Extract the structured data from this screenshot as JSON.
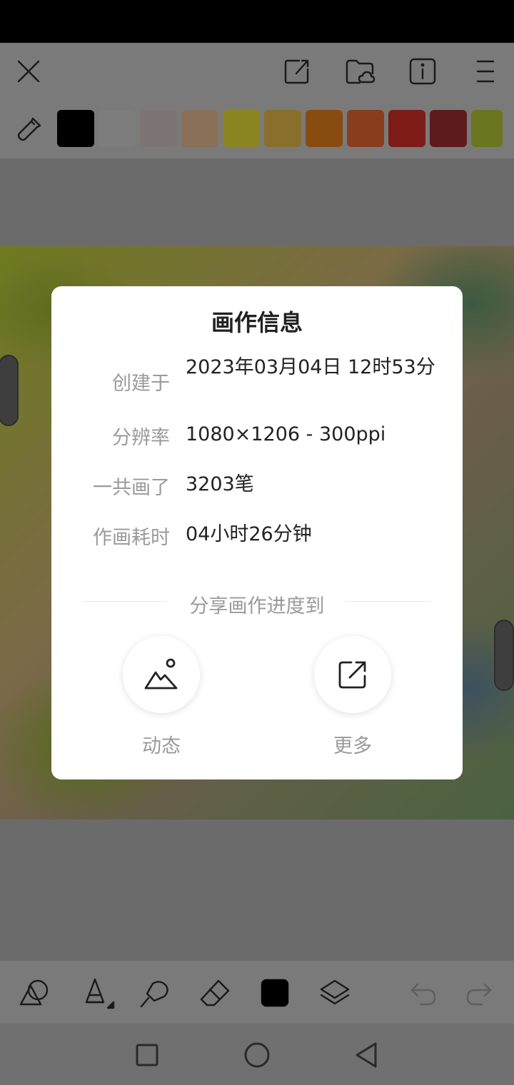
{
  "top_bar": {
    "icons": [
      "close-icon",
      "export-icon",
      "cloud-folder-icon",
      "info-icon",
      "menu-icon"
    ]
  },
  "palette": {
    "colors": [
      "#000000",
      "#7d7d7d",
      "#7c7573",
      "#8b7058",
      "#8a8521",
      "#8a6f2b",
      "#894c10",
      "#8a3d1c",
      "#7d1b17",
      "#5e1b1e",
      "#6a761d"
    ]
  },
  "dialog": {
    "title": "画作信息",
    "rows": [
      {
        "label": "创建于",
        "value": "2023年03月04日 12时53分"
      },
      {
        "label": "分辨率",
        "value": "1080×1206 - 300ppi"
      },
      {
        "label": "一共画了",
        "value": "3203笔"
      },
      {
        "label": "作画耗时",
        "value": "04小时26分钟"
      }
    ],
    "share_heading": "分享画作进度到",
    "share_buttons": [
      {
        "label": "动态",
        "icon": "image-post-icon"
      },
      {
        "label": "更多",
        "icon": "external-share-icon"
      }
    ]
  },
  "bottom_toolbar": {
    "icons": [
      "shapes-icon",
      "brush-icon",
      "smudge-icon",
      "eraser-icon",
      "color-square-icon",
      "layers-icon",
      "undo-icon",
      "redo-icon"
    ]
  },
  "nav_bar": {
    "icons": [
      "recents-square-icon",
      "home-circle-icon",
      "back-triangle-icon"
    ]
  }
}
